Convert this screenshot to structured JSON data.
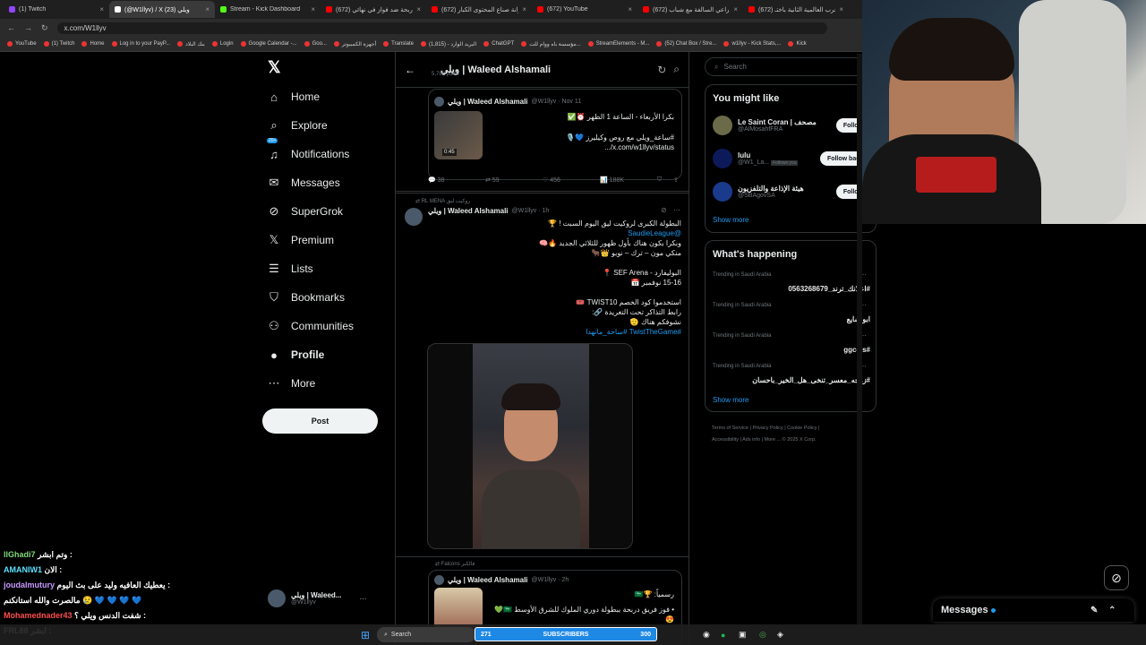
{
  "browser": {
    "tabs": [
      {
        "label": "(1) Twitch",
        "color": "#9146ff"
      },
      {
        "label": "(@W1llyv) / X ويلي (23)",
        "color": "#ffffff",
        "active": true
      },
      {
        "label": "Stream - Kick Dashboard",
        "color": "#53fc18"
      },
      {
        "label": "(672) دربحة ضد فواز في نهائي",
        "color": "#ff0000"
      },
      {
        "label": "(672) ميزانة صناع المحتوى الكبار",
        "color": "#ff0000"
      },
      {
        "label": "(672) YouTube",
        "color": "#ff0000"
      },
      {
        "label": "(672) من راعي السالفة مع شباب",
        "color": "#ff0000"
      },
      {
        "label": "(672) الحرب العالمية الثانية باختـ",
        "color": "#ff0000"
      }
    ],
    "url": "x.com/W1llyv",
    "bookmarks": [
      "YouTube",
      "(1) Twitch",
      "Home",
      "Log in to your PayP...",
      "بنك البلاد",
      "Login",
      "Google Calendar -...",
      "Goo...",
      "أجهزة الكمبيوتر",
      "Translate",
      "البريد الوارد - (1,815)",
      "ChatGPT",
      "مؤسسة باه ووام للت...",
      "StreamElements - M...",
      "(52) Chat Box / Stre...",
      "w1llyv - Kick Stats,...",
      "Kick"
    ]
  },
  "nav": {
    "items": [
      {
        "label": "Home",
        "icon": "⌂",
        "name": "home"
      },
      {
        "label": "Explore",
        "icon": "⌕",
        "name": "explore"
      },
      {
        "label": "Notifications",
        "icon": "♫",
        "name": "notifications",
        "badge": "20+"
      },
      {
        "label": "Messages",
        "icon": "✉",
        "name": "messages"
      },
      {
        "label": "SuperGrok",
        "icon": "⊘",
        "name": "supergrok"
      },
      {
        "label": "Premium",
        "icon": "𝕏",
        "name": "premium"
      },
      {
        "label": "Lists",
        "icon": "☰",
        "name": "lists"
      },
      {
        "label": "Bookmarks",
        "icon": "⛉",
        "name": "bookmarks"
      },
      {
        "label": "Communities",
        "icon": "⚇",
        "name": "communities"
      },
      {
        "label": "Profile",
        "icon": "●",
        "name": "profile"
      },
      {
        "label": "More",
        "icon": "⋯",
        "name": "more"
      }
    ],
    "post_label": "Post",
    "account_name": "ويلي | Waleed...",
    "account_handle": "@W1llyv"
  },
  "profile_header": {
    "name": "ويلي | Waleed Alshamali",
    "posts": "5,788 posts"
  },
  "tweet1": {
    "name": "ويلي | Waleed Alshamali",
    "handle": "@W1llyv · Nov 11",
    "line1": "بكرا الأربعاء - الساعة 1 الظهر ⏰✅",
    "line2": "#ساعة_ويلي مع روص وكيليرز 💙🎙️",
    "line3": "x.com/w1llyv/status/...",
    "duration": "0:45",
    "replies": "38",
    "reposts": "59",
    "likes": "456",
    "views": "188K"
  },
  "tweet2": {
    "context": "RL MENA روكيت ليق",
    "name": "ويلي | Waleed Alshamali",
    "handle": "@W1llyv · 1h",
    "lines": [
      "البطولة الكبرى لروكيت ليق اليوم السبت ! 🏆",
      "@SaudieLeague",
      "وبكرا بكون هناك بأول ظهور للثلاثي الجديد 🔥🧠",
      "منكي مون – ترك – نوبو 👑🐂",
      "",
      "البوليفارد - SEF Arena 📍",
      "15-16 نوفمبر 📅",
      "",
      "استخدموا كود الخصم TWIST10 🎟️",
      "رابط التذاكر تحت التغريدة 🔗:",
      "نشوفكم هناك 🫡",
      "#TwistTheGame #ساحة_مانهدا"
    ]
  },
  "tweet3": {
    "context": "Falcons فالكنز",
    "name": "ويلي | Waleed Alshamali",
    "handle": "@W1llyv · 2h",
    "line1": "رسمياً: 🏆🇸🇦",
    "line2": "• فوز فريق دربحة ببطولة دوري الملوك للشرق الأوسط 🇸🇦💚😍"
  },
  "search_placeholder": "Search",
  "who_to_follow": {
    "title": "You might like",
    "users": [
      {
        "name": "Le Saint Coran | مصحف",
        "handle": "@AlMosahfFRA",
        "btn": "Follow",
        "color": "#6b6b4a"
      },
      {
        "name": "lulu",
        "handle": "@W1_La...",
        "follows_you": "Follows you",
        "btn": "Follow back",
        "color": "#0c1a5a"
      },
      {
        "name": "هيئة الإذاعة والتلفزيون",
        "handle": "@SBAgovSA",
        "btn": "Follow",
        "color": "#1a3b8c"
      }
    ],
    "show_more": "Show more"
  },
  "trends": {
    "title": "What's happening",
    "items": [
      {
        "category": "Trending in Saudi Arabia",
        "topic": "#اعلانك_ترند_0563268679"
      },
      {
        "category": "Trending in Saudi Arabia",
        "topic": "ابو شايع"
      },
      {
        "category": "Trending in Saudi Arabia",
        "topic": "#ggccis"
      },
      {
        "category": "Trending in Saudi Arabia",
        "topic": "#زوجه_معسر_تنخى_هل_الخير_باحسان"
      }
    ],
    "show_more": "Show more"
  },
  "footer": {
    "line1": "Terms of Service  |  Privacy Policy  |  Cookie Policy  |",
    "line2": "Accessibility  |  Ads info  |  More ...  © 2025 X Corp."
  },
  "chat": [
    {
      "user": "llGhadi7",
      "text": "وتم ابشر :",
      "color": "#7fd97f"
    },
    {
      "user": "AMANIW1",
      "text": "الان :",
      "color": "#5be0ff"
    },
    {
      "user": "joudalmutury",
      "text": "يعطيك العافيه وليد على بث اليوم :",
      "color": "#c89aff"
    },
    {
      "user": "",
      "text": "مالصرت والله استانكنم 😢 💙 💙 💙 💙",
      "color": "#ffffff"
    },
    {
      "user": "Mohamednader43",
      "text": "شفت الدنس ويلي ؟ :",
      "color": "#ff4d4d"
    },
    {
      "user": "FRL88",
      "text": "ابشر :",
      "color": "#ffffff"
    }
  ],
  "taskbar": {
    "search": "Search",
    "subs_count": "271",
    "subs_label": "SUBSCRIBERS",
    "subs_goal": "300"
  },
  "messages_dock": "Messages"
}
